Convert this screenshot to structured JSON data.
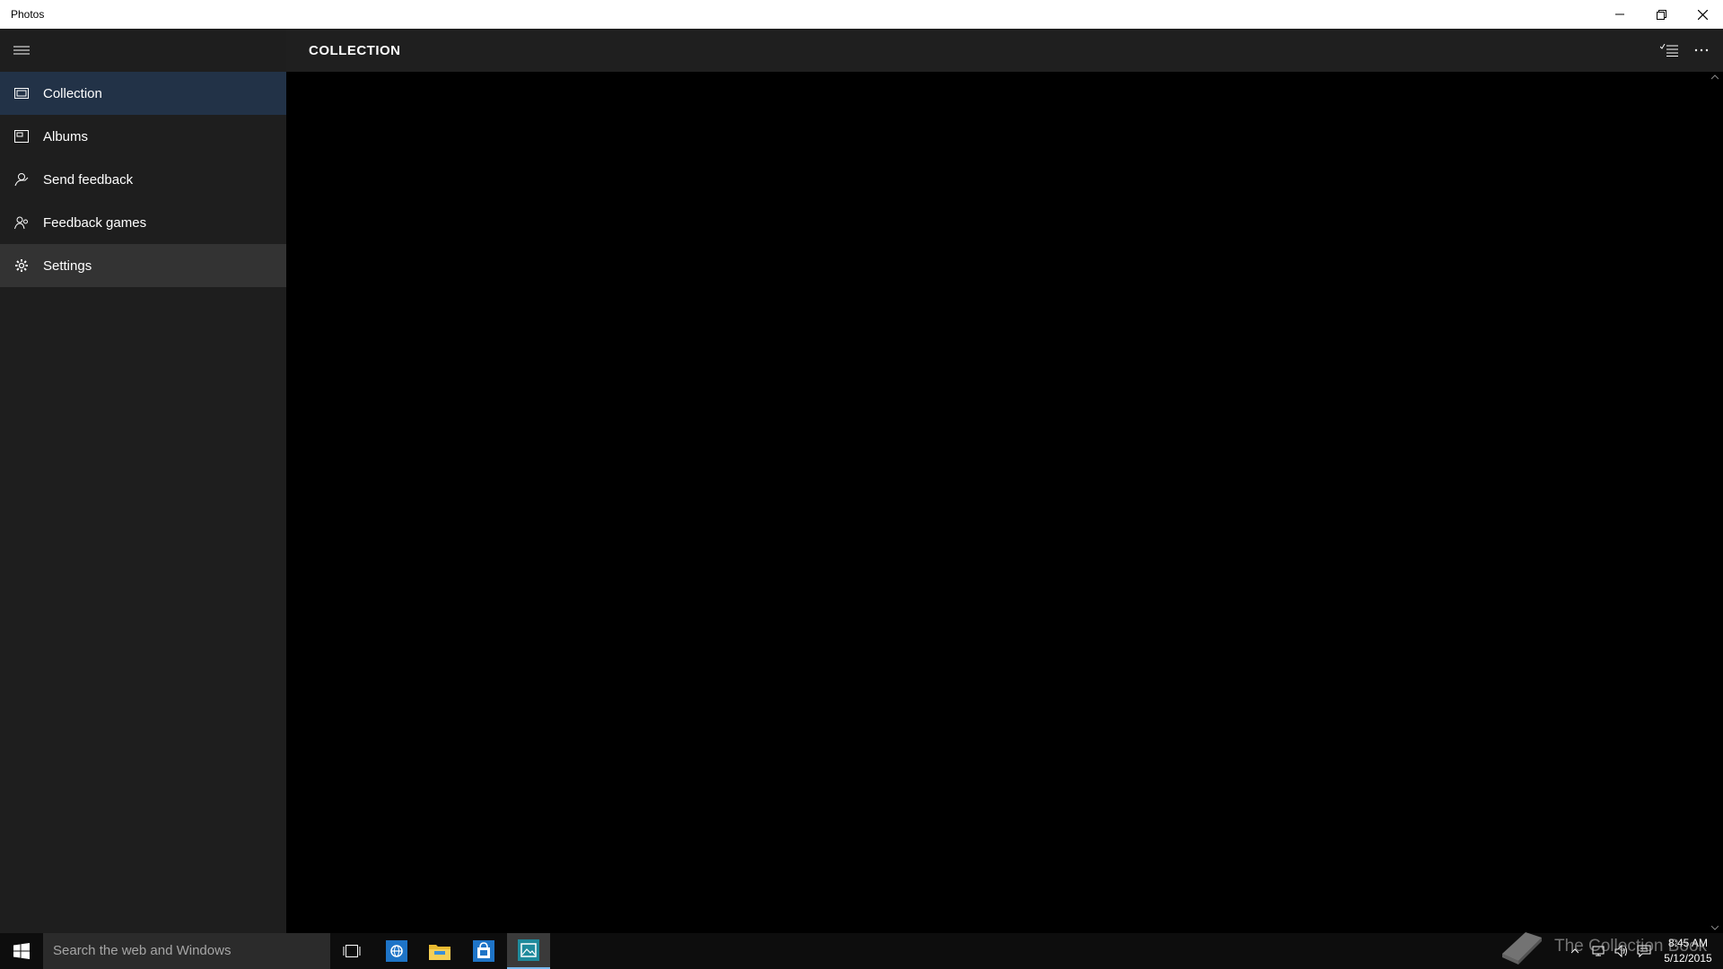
{
  "window": {
    "title": "Photos",
    "minimize_icon": "minimize-icon",
    "restore_icon": "restore-icon",
    "close_icon": "close-icon"
  },
  "sidebar": {
    "menu_icon": "hamburger-menu-icon",
    "items": [
      {
        "label": "Collection",
        "icon": "collection-icon",
        "state": "selected"
      },
      {
        "label": "Albums",
        "icon": "album-icon",
        "state": "normal"
      },
      {
        "label": "Send feedback",
        "icon": "feedback-icon",
        "state": "normal"
      },
      {
        "label": "Feedback games",
        "icon": "feedback-games-icon",
        "state": "normal"
      },
      {
        "label": "Settings",
        "icon": "gear-icon",
        "state": "hover"
      }
    ]
  },
  "header": {
    "title": "COLLECTION",
    "select_icon": "select-list-icon",
    "more_icon": "more-icon"
  },
  "taskbar": {
    "search_placeholder": "Search the web and Windows",
    "apps": [
      "task-view-icon",
      "ie-browser-icon",
      "file-explorer-icon",
      "store-icon",
      "photos-icon"
    ],
    "active_app": "photos-icon",
    "clock_time": "8:45 AM",
    "clock_date": "5/12/2015"
  },
  "watermark": {
    "text": "The Collection Book"
  },
  "colors": {
    "selected_bg": "#223247",
    "hover_bg": "#333333",
    "sidebar_bg": "#1e1e1e",
    "content_bg": "#000000",
    "accent": "#77b9ee"
  }
}
